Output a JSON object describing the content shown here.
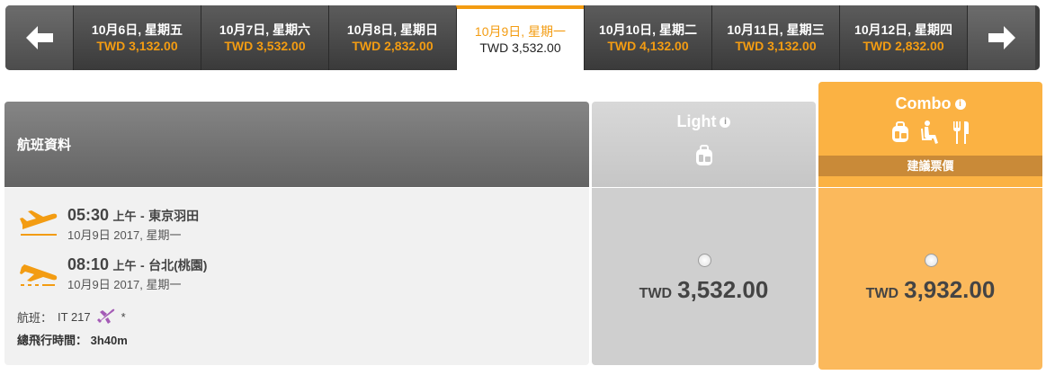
{
  "date_bar": {
    "prev_icon": "arrow-left-icon",
    "next_icon": "arrow-right-icon",
    "dates": [
      {
        "date": "10月6日, 星期五",
        "price": "TWD 3,132.00"
      },
      {
        "date": "10月7日, 星期六",
        "price": "TWD 3,532.00"
      },
      {
        "date": "10月8日, 星期日",
        "price": "TWD 2,832.00"
      },
      {
        "date": "10月9日, 星期一",
        "price": "TWD 3,532.00",
        "selected": true
      },
      {
        "date": "10月10日, 星期二",
        "price": "TWD 4,132.00"
      },
      {
        "date": "10月11日, 星期三",
        "price": "TWD 3,132.00"
      },
      {
        "date": "10月12日, 星期四",
        "price": "TWD 2,832.00"
      }
    ]
  },
  "flight_info": {
    "header": "航班資料",
    "departure": {
      "time": "05:30",
      "ampm": "上午",
      "city": "東京羽田",
      "date": "10月9日 2017, 星期一",
      "icon": "takeoff-plane-icon"
    },
    "arrival": {
      "time": "08:10",
      "ampm": "上午",
      "city": "台北(桃園)",
      "date": "10月9日 2017, 星期一",
      "icon": "landing-plane-icon"
    },
    "flight_label": "航班：",
    "flight_number": "IT 217",
    "flight_note": "*",
    "airline_icon": "tigerair-plane-icon",
    "duration_label": "總飛行時間：",
    "duration": "3h40m"
  },
  "fares": {
    "light": {
      "name": "Light",
      "currency": "TWD",
      "amount": "3,532.00",
      "icons": [
        "carry-on-bag-icon"
      ]
    },
    "combo": {
      "name": "Combo",
      "badge": "建議票價",
      "currency": "TWD",
      "amount": "3,932.00",
      "icons": [
        "baggage-icon",
        "seat-icon",
        "meal-icon"
      ]
    }
  },
  "colors": {
    "accent": "#f39c12",
    "combo": "#fbb243",
    "combo_dark": "#c98a38",
    "light": "#cfcfcf"
  }
}
